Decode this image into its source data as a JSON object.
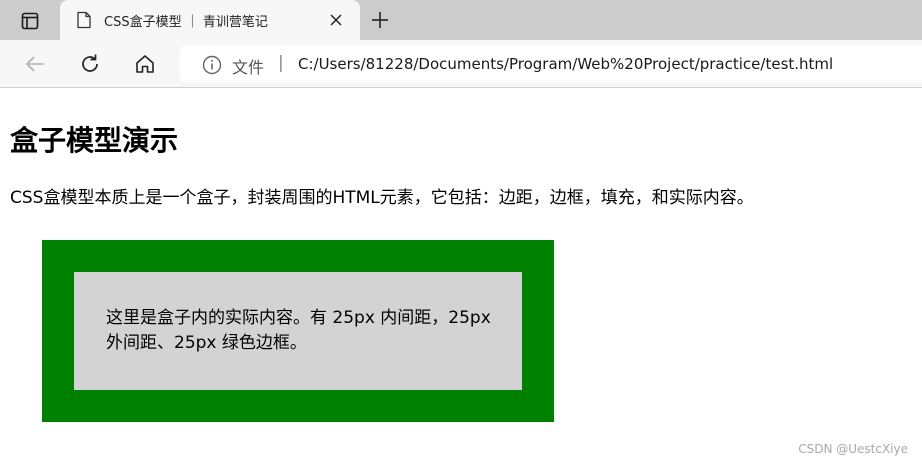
{
  "browser": {
    "tab": {
      "title": "CSS盒子模型 ｜ 青训营笔记"
    },
    "address_bar": {
      "file_label": "文件",
      "separator": "|",
      "url": "C:/Users/81228/Documents/Program/Web%20Project/practice/test.html"
    },
    "icons": {
      "tab_actions": "tab-actions-icon",
      "favicon": "document-icon",
      "close": "close-icon",
      "new_tab": "plus-icon",
      "back": "arrow-left-icon",
      "reload": "reload-icon",
      "home": "home-icon",
      "info": "info-icon"
    }
  },
  "page": {
    "heading": "盒子模型演示",
    "paragraph": "CSS盒模型本质上是一个盒子，封装周围的HTML元素，它包括：边距，边框，填充，和实际内容。",
    "box_text": "这里是盒子内的实际内容。有 25px 内间距，25px 外间距、25px 绿色边框。",
    "colors": {
      "box_border": "#008000",
      "box_background": "#d3d3d3"
    }
  },
  "watermark": "CSDN @UestcXiye"
}
